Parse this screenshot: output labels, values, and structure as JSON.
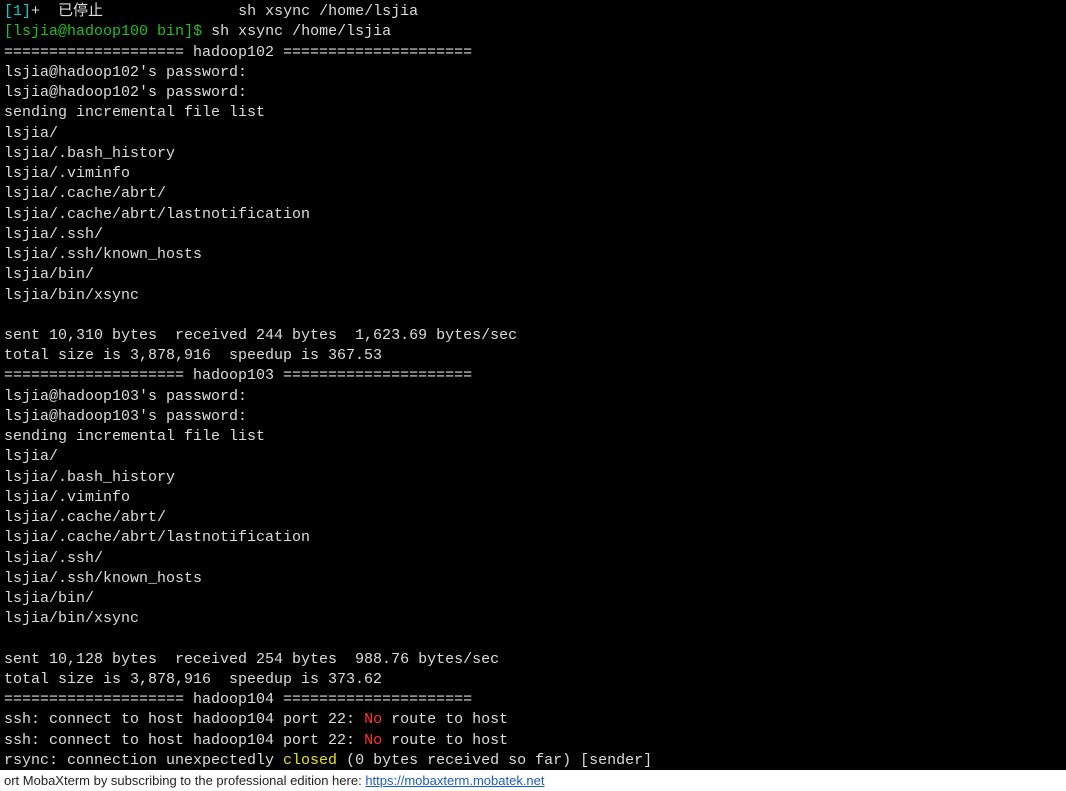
{
  "job": {
    "id": "[1]",
    "plus": "+",
    "status": "已停止",
    "cmd": "sh xsync /home/lsjia"
  },
  "prompt": {
    "open": "[",
    "userhost": "lsjia@hadoop100",
    "cwd": " bin",
    "close": "]$ ",
    "cmd": "sh xsync /home/lsjia"
  },
  "sep102": "==================== hadoop102 =====================",
  "h102": {
    "pw1": "lsjia@hadoop102's password:",
    "pw2": "lsjia@hadoop102's password:",
    "sending": "sending incremental file list",
    "files": [
      "lsjia/",
      "lsjia/.bash_history",
      "lsjia/.viminfo",
      "lsjia/.cache/abrt/",
      "lsjia/.cache/abrt/lastnotification",
      "lsjia/.ssh/",
      "lsjia/.ssh/known_hosts",
      "lsjia/bin/",
      "lsjia/bin/xsync"
    ],
    "sent": "sent 10,310 bytes  received 244 bytes  1,623.69 bytes/sec",
    "total": "total size is 3,878,916  speedup is 367.53"
  },
  "sep103": "==================== hadoop103 =====================",
  "h103": {
    "pw1": "lsjia@hadoop103's password:",
    "pw2": "lsjia@hadoop103's password:",
    "sending": "sending incremental file list",
    "files": [
      "lsjia/",
      "lsjia/.bash_history",
      "lsjia/.viminfo",
      "lsjia/.cache/abrt/",
      "lsjia/.cache/abrt/lastnotification",
      "lsjia/.ssh/",
      "lsjia/.ssh/known_hosts",
      "lsjia/bin/",
      "lsjia/bin/xsync"
    ],
    "sent": "sent 10,128 bytes  received 254 bytes  988.76 bytes/sec",
    "total": "total size is 3,878,916  speedup is 373.62"
  },
  "sep104": "==================== hadoop104 =====================",
  "h104": {
    "ssh_pre": "ssh: connect to host hadoop104 port 22: ",
    "no": "No",
    "route": " route to host",
    "rsync_pre": "rsync: connection unexpectedly ",
    "closed": "closed",
    "rsync_post": " (0 bytes received so far) [sender]"
  },
  "footer": {
    "text": "ort MobaXterm by subscribing to the professional edition here:  ",
    "link": "https://mobaxterm.mobatek.net"
  }
}
